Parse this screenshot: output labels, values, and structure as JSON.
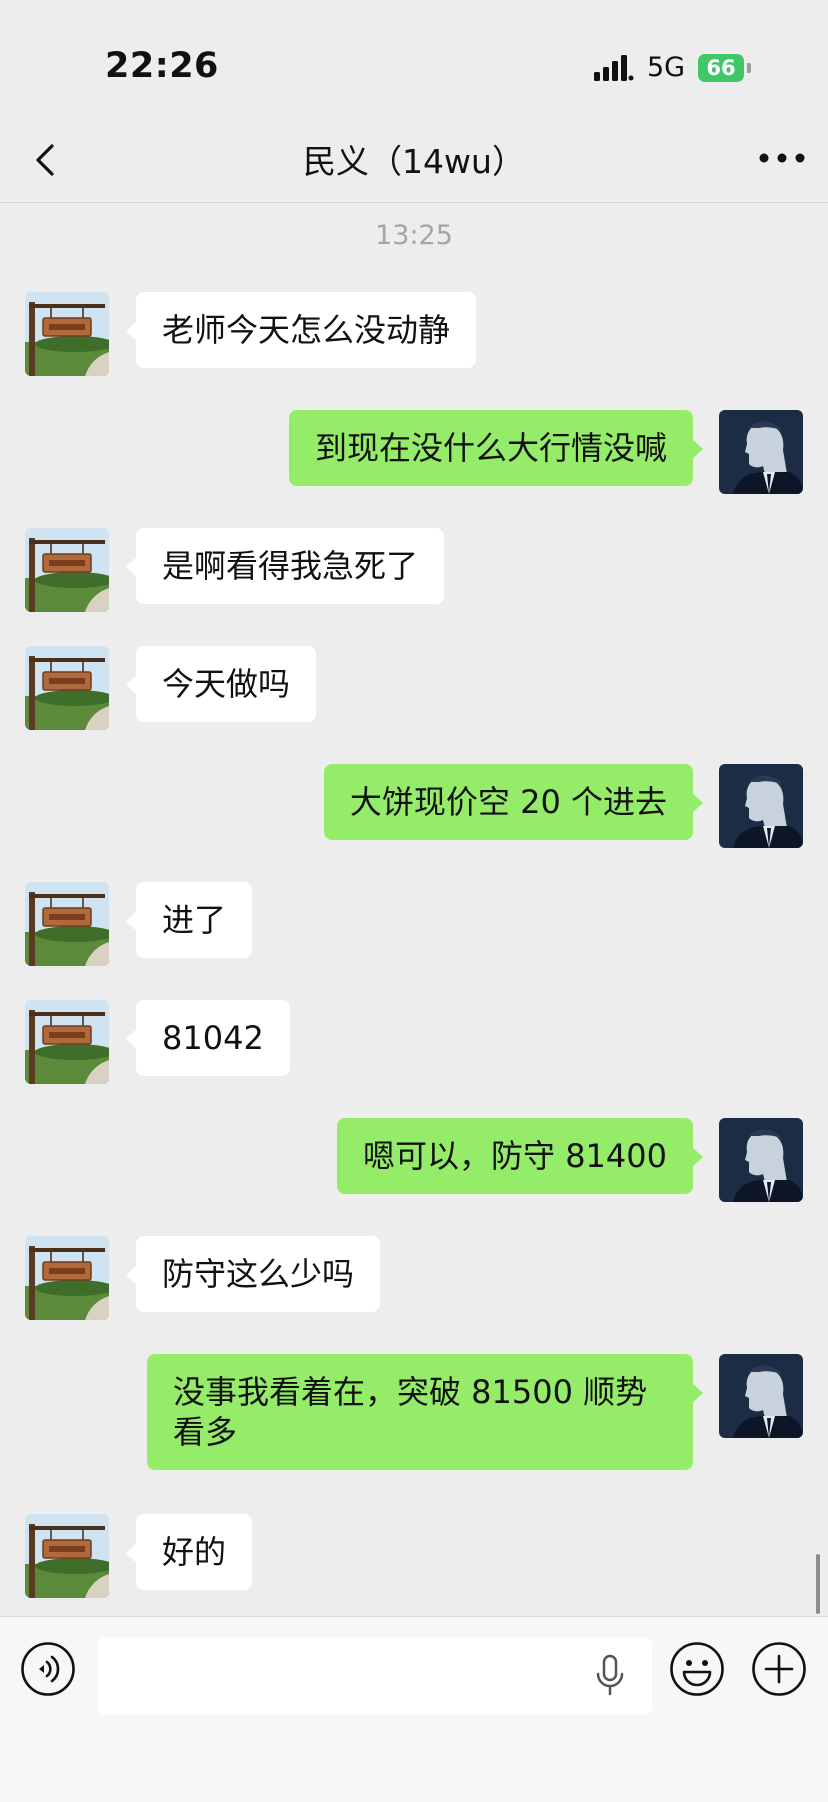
{
  "status_bar": {
    "time": "22:26",
    "network": "5G",
    "battery": "66",
    "signal_icon": "signal-bars-icon"
  },
  "header": {
    "title": "民义（14wu）",
    "back_icon": "chevron-left-icon",
    "more_icon": "more-dots-icon"
  },
  "conversation": {
    "timestamp": "13:25",
    "messages": [
      {
        "side": "in",
        "text": "老师今天怎么没动静"
      },
      {
        "side": "out",
        "text": "到现在没什么大行情没喊"
      },
      {
        "side": "in",
        "text": "是啊看得我急死了"
      },
      {
        "side": "in",
        "text": "今天做吗"
      },
      {
        "side": "out",
        "text": "大饼现价空 20 个进去"
      },
      {
        "side": "in",
        "text": "进了"
      },
      {
        "side": "in",
        "text": "81042"
      },
      {
        "side": "out",
        "text": "嗯可以，防守 81400"
      },
      {
        "side": "in",
        "text": "防守这么少吗"
      },
      {
        "side": "out",
        "text": "没事我看着在，突破 81500 顺势看多"
      },
      {
        "side": "in",
        "text": "好的"
      }
    ]
  },
  "input_bar": {
    "input_value": "",
    "voice_icon": "voice-toggle-icon",
    "mic_icon": "microphone-icon",
    "emoji_icon": "emoji-icon",
    "plus_icon": "plus-icon"
  },
  "colors": {
    "background": "#ededed",
    "incoming_bubble": "#ffffff",
    "outgoing_bubble": "#95ec69",
    "battery": "#3fc768"
  }
}
